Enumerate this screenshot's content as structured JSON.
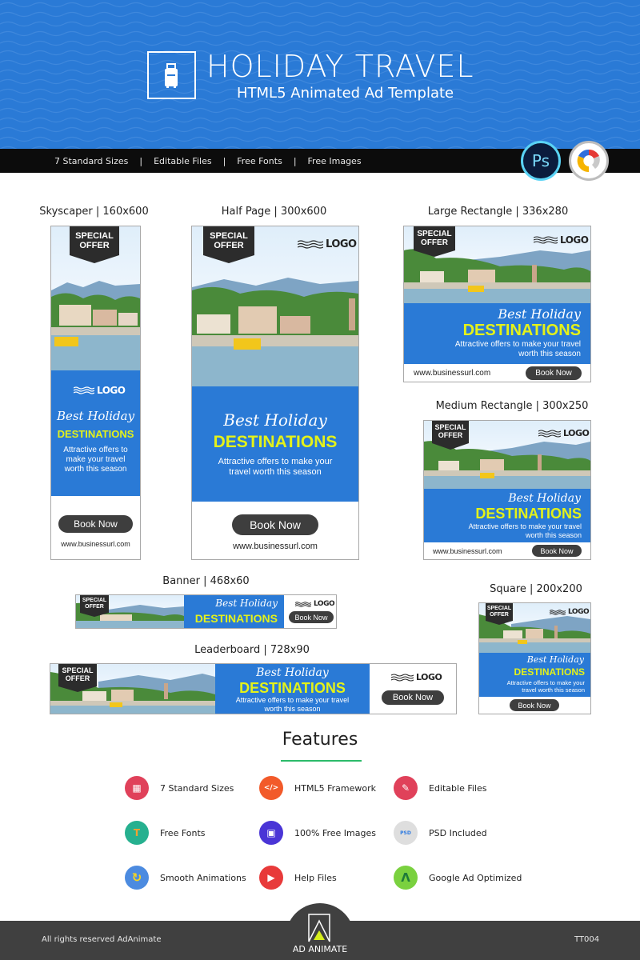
{
  "hero": {
    "title": "HOLIDAY TRAVEL",
    "subtitle": "HTML5 Animated Ad Template",
    "icon": "luggage-icon",
    "background_color": "#2a7ad6"
  },
  "strip": {
    "items": [
      "7 Standard Sizes",
      "Editable Files",
      "Free Fonts",
      "Free Images"
    ],
    "separator": "|",
    "badges": [
      {
        "name": "photoshop-icon",
        "label": "Ps"
      },
      {
        "name": "google-web-designer-icon",
        "label": ""
      }
    ]
  },
  "ad_common": {
    "badge_line1": "SPECIAL",
    "badge_line2": "OFFER",
    "logo_text": "LOGO",
    "script_heading": "Best Holiday",
    "heading": "DESTINATIONS",
    "sub_text": "Attractive offers to make your travel worth this season",
    "sub_short_1": "Attractive offers to",
    "sub_short_2": "make your travel",
    "sub_short_3": "worth this season",
    "sub_half_1": "Attractive offers to make your",
    "sub_half_2": "travel worth this season",
    "sub_wide_1": "Attractive offers to make your travel",
    "sub_wide_2": "worth this season",
    "cta": "Book Now",
    "url": "www.businessurl.com",
    "accent_color": "#2a7ad6",
    "heading_color": "#e4f219",
    "button_color": "#3e3e3e"
  },
  "ads": {
    "skyscraper": {
      "label": "Skyscaper | 160x600"
    },
    "half_page": {
      "label": "Half Page | 300x600"
    },
    "large_rectangle": {
      "label": "Large Rectangle | 336x280"
    },
    "medium_rectangle": {
      "label": "Medium Rectangle | 300x250"
    },
    "banner": {
      "label": "Banner | 468x60"
    },
    "leaderboard": {
      "label": "Leaderboard | 728x90"
    },
    "square": {
      "label": "Square | 200x200"
    }
  },
  "features": {
    "title": "Features",
    "items": [
      {
        "label": "7 Standard Sizes",
        "icon": "resize-icon",
        "color": "#e0415a",
        "glyph": "▦"
      },
      {
        "label": "HTML5 Framework",
        "icon": "html-file-icon",
        "color": "#f25a2a",
        "glyph": "</>"
      },
      {
        "label": "Editable Files",
        "icon": "edit-document-icon",
        "color": "#e0415a",
        "glyph": "✎"
      },
      {
        "label": "Free Fonts",
        "icon": "font-icon",
        "color": "#26b08f",
        "glyph": "T"
      },
      {
        "label": "100% Free Images",
        "icon": "images-icon",
        "color": "#4a35d6",
        "glyph": "▣"
      },
      {
        "label": "PSD Included",
        "icon": "psd-file-icon",
        "color": "#dedede",
        "glyph": "PSD"
      },
      {
        "label": "Smooth Animations",
        "icon": "animation-loop-icon",
        "color": "#4c8be0",
        "glyph": "↻"
      },
      {
        "label": "Help Files",
        "icon": "help-file-icon",
        "color": "#e83a3a",
        "glyph": "▶"
      },
      {
        "label": "Google Ad Optimized",
        "icon": "google-ads-icon",
        "color": "#7ad13f",
        "glyph": "Λ"
      }
    ]
  },
  "footer": {
    "copyright": "All rights reserved AdAnimate",
    "brand": "AD ANIMATE",
    "code": "TT004"
  }
}
